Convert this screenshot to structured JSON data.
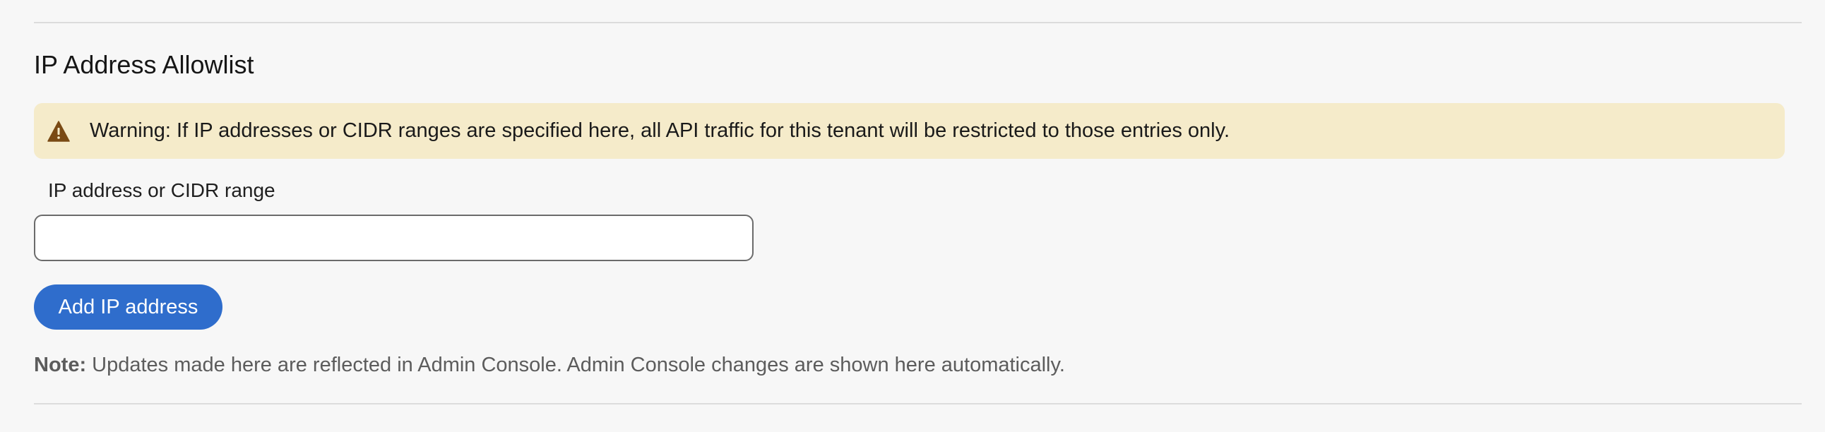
{
  "section": {
    "title": "IP Address Allowlist"
  },
  "warning": {
    "icon": "warning-triangle-icon",
    "text": "Warning: If IP addresses or CIDR ranges are specified here, all API traffic for this tenant will be restricted to those entries only.",
    "background_color": "#f5ebca",
    "icon_color": "#7a4a14"
  },
  "ip_field": {
    "label": "IP address or CIDR range",
    "value": "",
    "placeholder": ""
  },
  "add_button": {
    "label": "Add IP address",
    "color": "#2f6dcc"
  },
  "note": {
    "label": "Note:",
    "text": " Updates made here are reflected in Admin Console. Admin Console changes are shown here automatically."
  }
}
